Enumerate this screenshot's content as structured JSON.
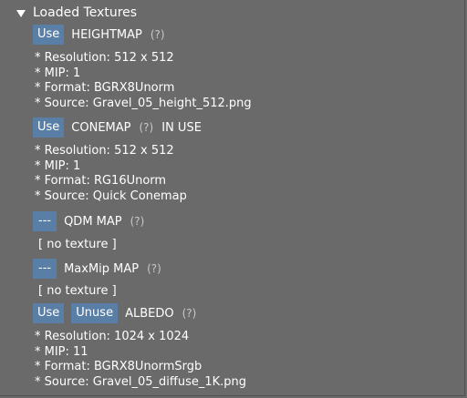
{
  "section": {
    "title": "Loaded Textures"
  },
  "textures": [
    {
      "buttons": [
        "Use"
      ],
      "name": "HEIGHTMAP",
      "help": "(?)",
      "status": "",
      "details": [
        "* Resolution: 512 x 512",
        "* MIP: 1",
        "* Format: BGRX8Unorm",
        "* Source: Gravel_05_height_512.png"
      ]
    },
    {
      "buttons": [
        "Use"
      ],
      "name": "CONEMAP",
      "help": "(?)",
      "status": "IN USE",
      "details": [
        "* Resolution: 512 x 512",
        "* MIP: 1",
        "* Format: RG16Unorm",
        "* Source: Quick Conemap"
      ]
    },
    {
      "buttons": [
        "---"
      ],
      "name": "QDM MAP",
      "help": "(?)",
      "status": "",
      "empty": "[ no texture ]"
    },
    {
      "buttons": [
        "---"
      ],
      "name": "MaxMip MAP",
      "help": "(?)",
      "status": "",
      "empty": "[ no texture ]"
    },
    {
      "buttons": [
        "Use",
        "Unuse"
      ],
      "name": "ALBEDO",
      "help": "(?)",
      "status": "",
      "details": [
        "* Resolution: 1024 x 1024",
        "* MIP: 11",
        "* Format: BGRX8UnormSrgb",
        "* Source: Gravel_05_diffuse_1K.png"
      ]
    }
  ],
  "colors": {
    "background": "#6a6a6a",
    "button": "#5a7fa6",
    "text": "#ffffff"
  }
}
